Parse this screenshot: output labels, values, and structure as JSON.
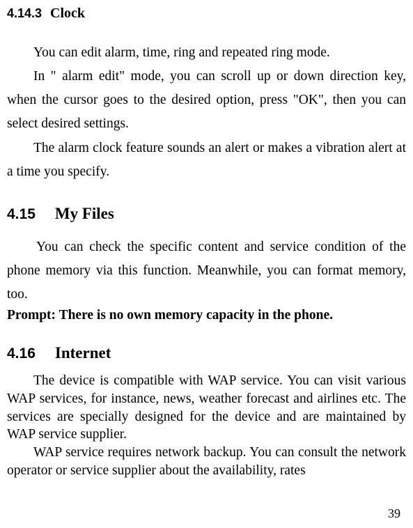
{
  "sections": {
    "s1": {
      "number": "4.14.3",
      "title": "Clock",
      "p1": "You can edit alarm, time, ring and repeated ring mode.",
      "p2": "In \" alarm edit\" mode,   you can scroll up or down direction key, when the cursor goes to the desired option, press \"OK\", then you can select desired settings.",
      "p3": "The alarm clock feature sounds an alert or makes a vibration alert at a time you specify."
    },
    "s2": {
      "number": "4.15",
      "title": "My Files",
      "p1": "You can check the specific content and service condition of the phone memory via this function. Meanwhile, you can format memory, too.",
      "prompt": "Prompt: There is no own memory capacity in the phone."
    },
    "s3": {
      "number": "4.16",
      "title": "Internet",
      "p1": "The device is compatible with WAP service. You can visit various WAP services, for instance, news, weather forecast and airlines etc. The services are specially designed for the device and are maintained by WAP service supplier.",
      "p2": "WAP service requires network backup. You can consult the network operator or service supplier about the availability, rates"
    }
  },
  "pageNumber": "39"
}
